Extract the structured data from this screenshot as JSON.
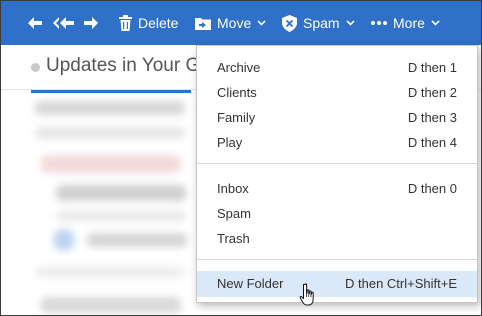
{
  "toolbar": {
    "delete_label": "Delete",
    "move_label": "Move",
    "spam_label": "Spam",
    "more_label": "More",
    "background_color": "#2f71c8"
  },
  "message": {
    "subject": "Updates in Your Gro"
  },
  "move_menu": {
    "group1": [
      {
        "label": "Archive",
        "shortcut": "D then 1"
      },
      {
        "label": "Clients",
        "shortcut": "D then 2"
      },
      {
        "label": "Family",
        "shortcut": "D then 3"
      },
      {
        "label": "Play",
        "shortcut": "D then 4"
      }
    ],
    "group2": [
      {
        "label": "Inbox",
        "shortcut": "D then 0"
      },
      {
        "label": "Spam",
        "shortcut": ""
      },
      {
        "label": "Trash",
        "shortcut": ""
      }
    ],
    "new_folder": {
      "label": "New Folder",
      "shortcut": "D then Ctrl+Shift+E"
    },
    "hover_color": "#dbe8f8"
  },
  "icons": {
    "reply": "reply-icon",
    "reply_all": "reply-all-icon",
    "forward": "forward-icon",
    "delete": "trash-icon",
    "move": "folder-move-icon",
    "spam": "shield-x-icon",
    "more": "ellipsis-icon",
    "cursor": "hand-pointer-icon"
  }
}
